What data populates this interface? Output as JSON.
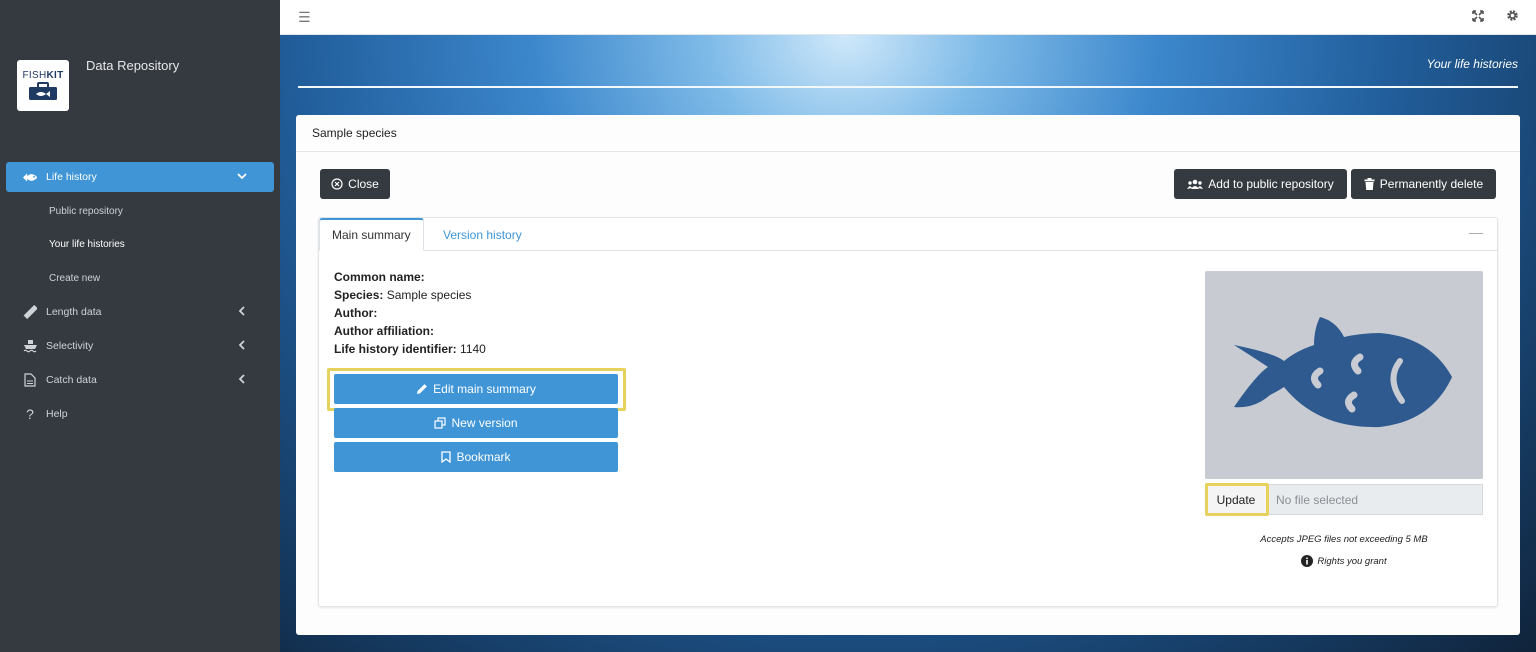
{
  "app": {
    "logo_text_plain": "FISH",
    "logo_text_bold": "KIT",
    "brand_title": "Data Repository"
  },
  "sidebar": {
    "items": [
      {
        "label": "Life history",
        "icon": "fish-icon",
        "active": true,
        "expanded": true
      },
      {
        "label": "Length data",
        "icon": "ruler-icon"
      },
      {
        "label": "Selectivity",
        "icon": "ship-icon"
      },
      {
        "label": "Catch data",
        "icon": "file-icon"
      },
      {
        "label": "Help",
        "icon": "question-icon"
      }
    ],
    "subitems": [
      {
        "label": "Public repository"
      },
      {
        "label": "Your life histories",
        "current": true
      },
      {
        "label": "Create new"
      }
    ]
  },
  "banner": {
    "title": "Your life histories"
  },
  "card": {
    "title": "Sample species",
    "close_label": "Close",
    "add_public_label": "Add to public repository",
    "delete_label": "Permanently delete"
  },
  "tabs": [
    {
      "label": "Main summary",
      "active": true
    },
    {
      "label": "Version history"
    }
  ],
  "summary": {
    "common_name_label": "Common name:",
    "common_name_value": "",
    "species_label": "Species:",
    "species_value": "Sample species",
    "author_label": "Author:",
    "author_value": "",
    "affiliation_label": "Author affiliation:",
    "affiliation_value": "",
    "identifier_label": "Life history identifier:",
    "identifier_value": "1140"
  },
  "actions": {
    "edit_label": "Edit main summary",
    "new_version_label": "New version",
    "bookmark_label": "Bookmark"
  },
  "image_panel": {
    "update_label": "Update",
    "file_placeholder": "No file selected",
    "accept_note": "Accepts JPEG files not exceeding 5 MB",
    "rights_label": "Rights you grant"
  },
  "colors": {
    "accent": "#3f95d6",
    "sidebar_bg": "#343a40",
    "highlight": "#e6d25d",
    "fish": "#2e5a8f"
  }
}
